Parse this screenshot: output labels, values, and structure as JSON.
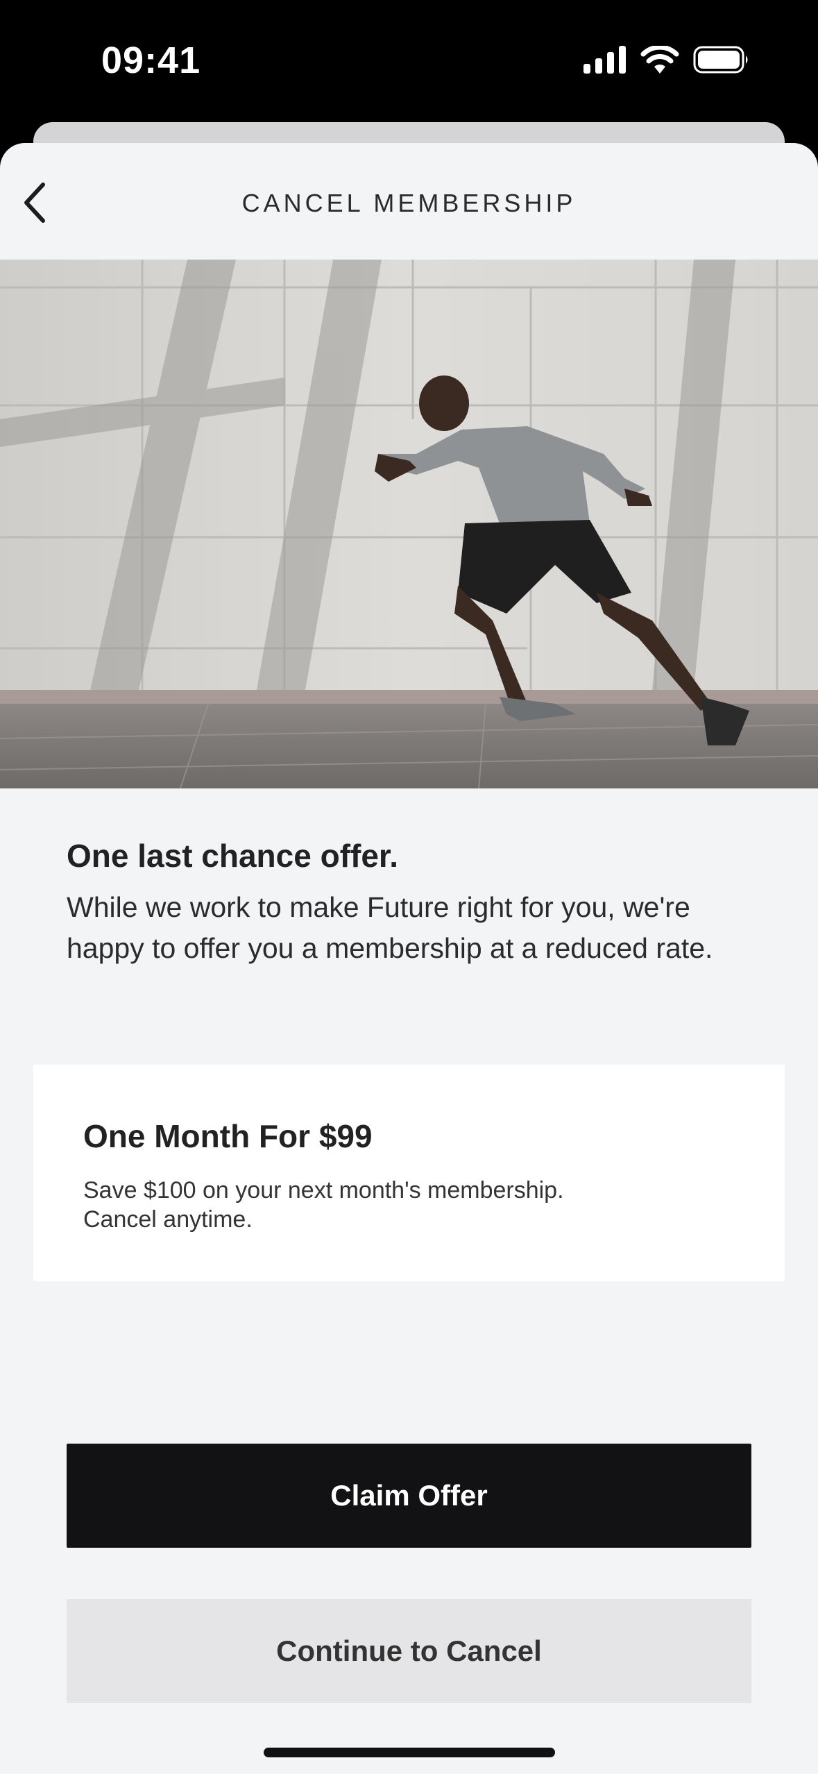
{
  "status_bar": {
    "time": "09:41",
    "icons": [
      "cellular-signal-icon",
      "wifi-icon",
      "battery-icon"
    ]
  },
  "nav": {
    "title": "CANCEL MEMBERSHIP",
    "back_icon": "chevron-left-icon"
  },
  "hero": {
    "alt": "sprinter-running-photo"
  },
  "offer": {
    "headline": "One last chance offer.",
    "body": "While we work to make Future right for you, we're happy to offer you a membership at a reduced rate.",
    "card_title": "One Month For $99",
    "card_line1": "Save $100 on your next month's membership.",
    "card_line2": "Cancel anytime."
  },
  "actions": {
    "claim_label": "Claim Offer",
    "cancel_label": "Continue to Cancel"
  },
  "colors": {
    "background": "#f3f4f6",
    "primary_button": "#121214",
    "secondary_button": "#e5e5e7"
  }
}
